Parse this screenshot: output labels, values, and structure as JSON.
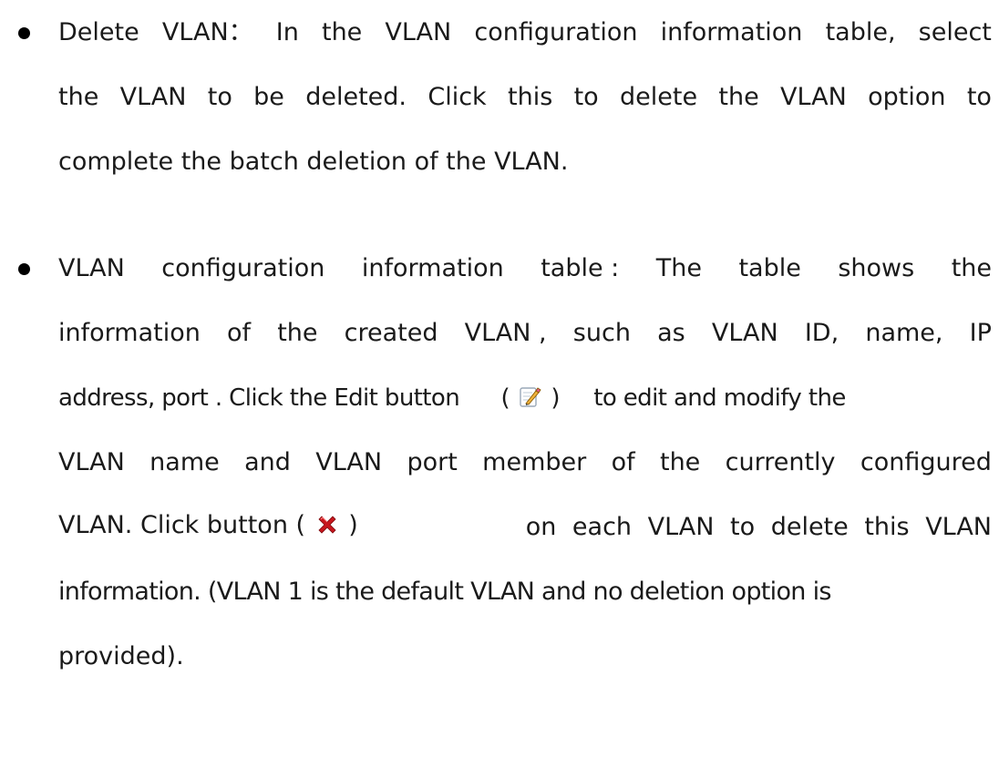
{
  "items": [
    {
      "label": "Delete VLAN",
      "lines": [
        [
          "Delete",
          "VLAN：",
          "In",
          "the",
          "VLAN",
          "configuration",
          "information",
          "table,",
          "select"
        ],
        [
          "the",
          "VLAN",
          "to",
          "be",
          "deleted.",
          "Click",
          "this",
          "to",
          "delete",
          "the",
          "VLAN",
          "option",
          "to"
        ],
        "complete the batch deletion of the VLAN."
      ]
    },
    {
      "label": "VLAN configuration information table",
      "lines": [
        [
          "VLAN",
          "configuration",
          "information",
          "table :",
          "The",
          "table",
          "shows",
          "the"
        ],
        [
          "information",
          "of",
          "the",
          "created",
          "VLAN ,",
          "such",
          "as",
          "VLAN",
          "ID,",
          "name,",
          "IP"
        ],
        {
          "before": "address, port . Click the Edit button",
          "paren_open": "(",
          "icon": "edit-icon",
          "paren_close": ")",
          "after": "to edit and modify the"
        },
        [
          "VLAN",
          "name",
          "and",
          "VLAN",
          "port",
          "member",
          "of",
          "the",
          "currently",
          "configured"
        ],
        {
          "before": "VLAN. Click button (",
          "icon": "delete-icon",
          "paren_close": ")",
          "after": "on each VLAN to delete this VLAN"
        },
        "information. (VLAN 1 is the default VLAN and no deletion option is",
        "provided)."
      ]
    }
  ]
}
